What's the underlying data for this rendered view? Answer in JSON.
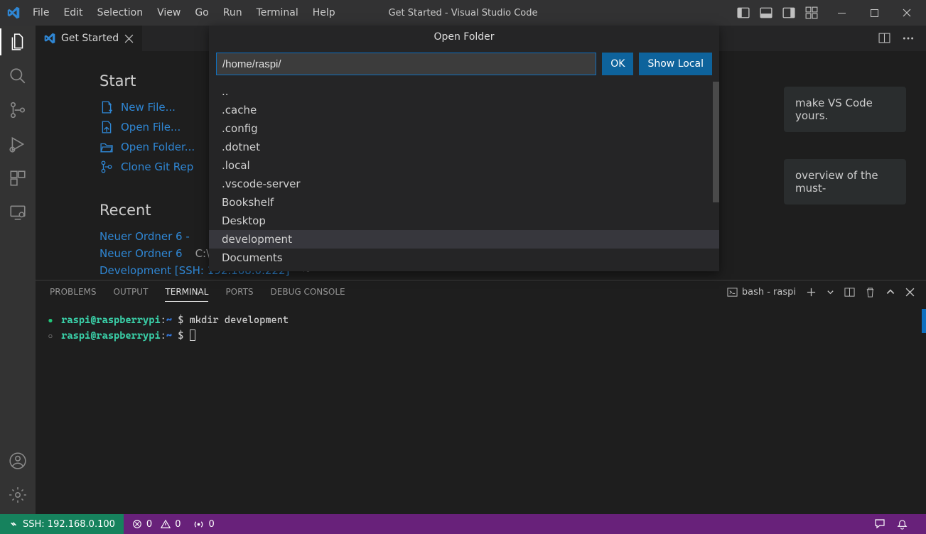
{
  "titlebar": {
    "menus": [
      "File",
      "Edit",
      "Selection",
      "View",
      "Go",
      "Run",
      "Terminal",
      "Help"
    ],
    "windowTitle": "Get Started - Visual Studio Code"
  },
  "tab": {
    "label": "Get Started"
  },
  "getStarted": {
    "startTitle": "Start",
    "startItems": {
      "newFile": "New File...",
      "openFile": "Open File...",
      "openFolder": "Open Folder...",
      "cloneRepo": "Clone Git Rep"
    },
    "recentTitle": "Recent",
    "recent": [
      {
        "name": "Neuer Ordner 6 -",
        "loc": ""
      },
      {
        "name": "Neuer Ordner 6",
        "loc": "C:\\Users\\apps\\Desktop"
      },
      {
        "name": "Development [SSH: 192.168.0.222]",
        "loc": "~"
      }
    ],
    "cardA": "make VS Code yours.",
    "cardB": "overview of the must-"
  },
  "panel": {
    "tabs": {
      "problems": "PROBLEMS",
      "output": "OUTPUT",
      "terminal": "TERMINAL",
      "ports": "PORTS",
      "debug": "DEBUG CONSOLE"
    },
    "terminalName": "bash - raspi",
    "lines": {
      "l1_prompt": "raspi@raspberrypi",
      "l1_path": ":",
      "l1_tilde": "~",
      "l1_dollar": " $ ",
      "l1_cmd": "mkdir development",
      "l2_prompt": "raspi@raspberrypi",
      "l2_path": ":",
      "l2_tilde": "~",
      "l2_dollar": " $ "
    }
  },
  "statusbar": {
    "ssh": "SSH: 192.168.0.100",
    "errors": "0",
    "warnings": "0",
    "ports": "0"
  },
  "dialog": {
    "title": "Open Folder",
    "path": "/home/raspi/",
    "ok": "OK",
    "showLocal": "Show Local",
    "items": {
      "i0": "..",
      "i1": ".cache",
      "i2": ".config",
      "i3": ".dotnet",
      "i4": ".local",
      "i5": ".vscode-server",
      "i6": "Bookshelf",
      "i7": "Desktop",
      "i8": "development",
      "i9": "Documents"
    }
  }
}
